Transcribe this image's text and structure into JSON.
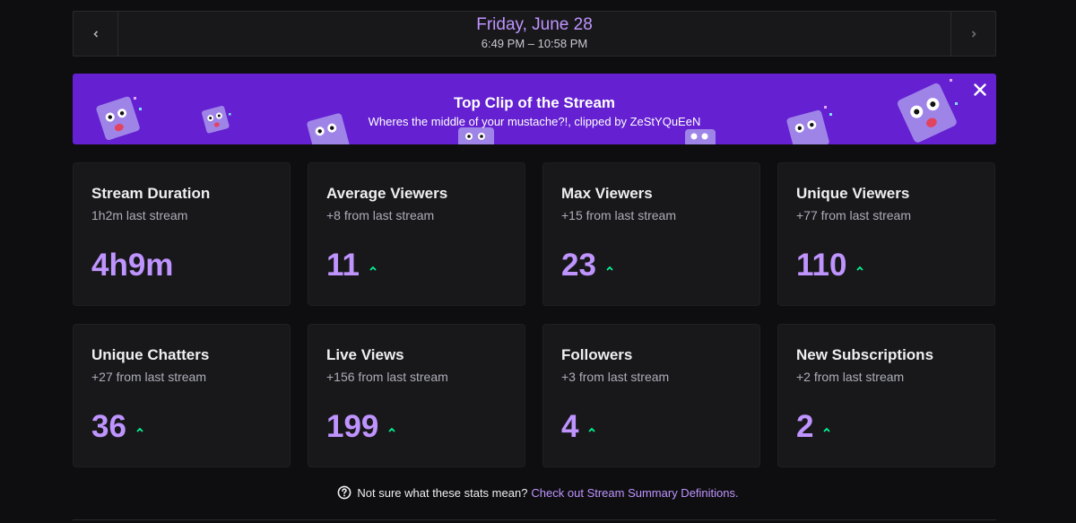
{
  "date_nav": {
    "title": "Friday, June 28",
    "time_range": "6:49 PM – 10:58 PM",
    "prev_icon": "chevron-left-icon",
    "next_icon": "chevron-right-icon"
  },
  "clip_banner": {
    "title": "Top Clip of the Stream",
    "subtitle": "Wheres the middle of your mustache?!, clipped by ZeStYQuEeN",
    "close_icon": "close-icon",
    "background": "#6420d1"
  },
  "stats": [
    {
      "title": "Stream Duration",
      "subtitle": "1h2m last stream",
      "value": "4h9m"
    },
    {
      "title": "Average Viewers",
      "subtitle": "+8 from last stream",
      "value": "11"
    },
    {
      "title": "Max Viewers",
      "subtitle": "+15 from last stream",
      "value": "23"
    },
    {
      "title": "Unique Viewers",
      "subtitle": "+77 from last stream",
      "value": "110"
    },
    {
      "title": "Unique Chatters",
      "subtitle": "+27 from last stream",
      "value": "36"
    },
    {
      "title": "Live Views",
      "subtitle": "+156 from last stream",
      "value": "199"
    },
    {
      "title": "Followers",
      "subtitle": "+3 from last stream",
      "value": "4"
    },
    {
      "title": "New Subscriptions",
      "subtitle": "+2 from last stream",
      "value": "2"
    }
  ],
  "help": {
    "icon": "question-circle-icon",
    "text": "Not sure what these stats mean?",
    "link": "Check out Stream Summary Definitions."
  },
  "colors": {
    "accent": "#bf94ff",
    "up": "#00f593",
    "card_bg": "#18181b",
    "page_bg": "#0e0e10"
  }
}
